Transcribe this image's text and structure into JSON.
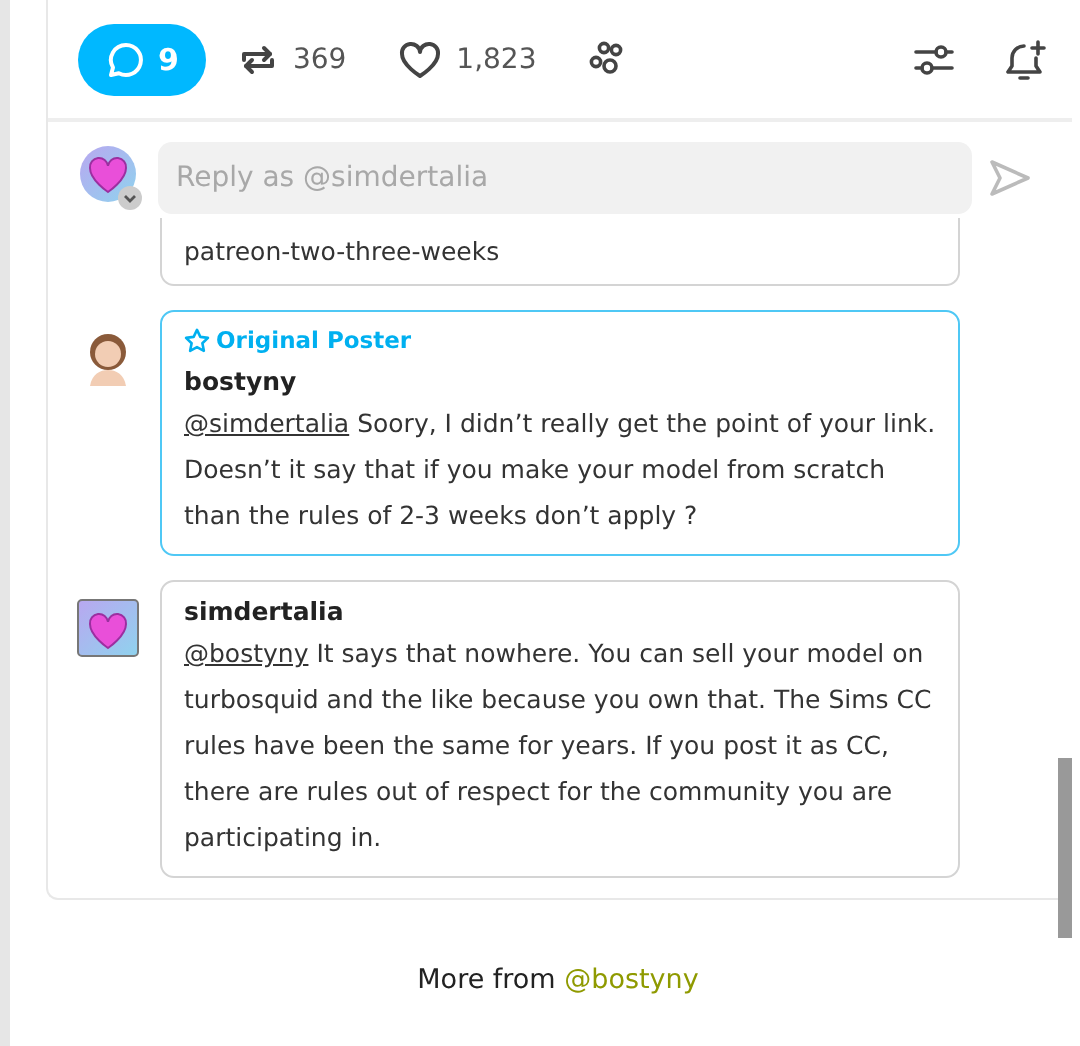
{
  "toolbar": {
    "replies": {
      "count": "9",
      "selected": true
    },
    "reblogs": "369",
    "likes": "1,823"
  },
  "reply_field": {
    "placeholder": "Reply as @simdertalia"
  },
  "comments": [
    {
      "kind": "partial",
      "original_poster": false,
      "text": "patreon-two-three-weeks"
    },
    {
      "kind": "full",
      "square_avatar": false,
      "original_poster": true,
      "badge": "Original Poster",
      "author": "bostyny",
      "mention": "@simdertalia",
      "text": "Soory, I didn’t really get the point of your link. Doesn’t it say that if you make your model from scratch than the rules of 2-3 weeks don’t apply ?"
    },
    {
      "kind": "full",
      "square_avatar": true,
      "original_poster": false,
      "author": "simdertalia",
      "mention": "@bostyny",
      "text": "It says that nowhere. You can sell your model on turbosquid and the like because you own that. The Sims CC rules have been the same for years. If you post it as CC, there are rules out of respect for the community you are participating in."
    }
  ],
  "footer": {
    "label": "More from",
    "user": "@bostyny"
  }
}
